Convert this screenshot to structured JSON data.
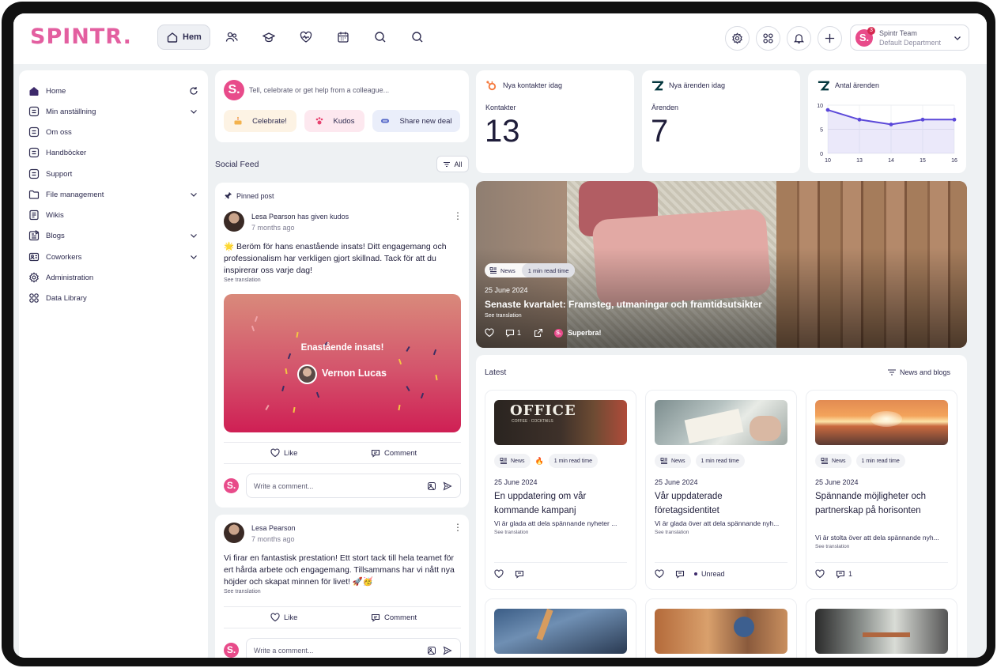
{
  "brand": {
    "logo": "SPINTR.",
    "accent": "#e35fa0"
  },
  "topnav": {
    "home_label": "Hem",
    "icons": [
      "people-icon",
      "graduation-cap-icon",
      "heart-pulse-icon",
      "calendar-icon",
      "search-icon",
      "search-icon"
    ]
  },
  "header_actions": [
    "gear-icon",
    "apps-grid-icon",
    "bell-icon",
    "plus-icon"
  ],
  "profile": {
    "avatar_letter": "S.",
    "badge": "3",
    "name": "Spintr Team",
    "department": "Default Department"
  },
  "sidebar": {
    "items": [
      {
        "label": "Home",
        "icon": "home-icon",
        "chevron": false,
        "refresh": true
      },
      {
        "label": "Min anställning",
        "icon": "page-icon",
        "chevron": true
      },
      {
        "label": "Om oss",
        "icon": "page-icon",
        "chevron": false
      },
      {
        "label": "Handböcker",
        "icon": "page-icon",
        "chevron": false
      },
      {
        "label": "Support",
        "icon": "page-icon",
        "chevron": false
      },
      {
        "label": "File management",
        "icon": "folder-icon",
        "chevron": true
      },
      {
        "label": "Wikis",
        "icon": "book-icon",
        "chevron": false
      },
      {
        "label": "Blogs",
        "icon": "blog-icon",
        "chevron": true
      },
      {
        "label": "Coworkers",
        "icon": "id-card-icon",
        "chevron": true
      },
      {
        "label": "Administration",
        "icon": "gear-icon",
        "chevron": false
      },
      {
        "label": "Data Library",
        "icon": "grid-icon",
        "chevron": false
      }
    ]
  },
  "composer": {
    "avatar_letter": "S.",
    "placeholder": "Tell, celebrate or get help from a colleague...",
    "chips": [
      {
        "label": "Celebrate!",
        "bg": "#fdf3e4"
      },
      {
        "label": "Kudos",
        "bg": "#fde8ef"
      },
      {
        "label": "Share new deal",
        "bg": "#eaeefa"
      }
    ]
  },
  "feed": {
    "title": "Social Feed",
    "filter_label": "All",
    "posts": [
      {
        "pinned_label": "Pinned post",
        "author": "Lesa Pearson",
        "action": "has given kudos",
        "time": "7 months ago",
        "text": "🌟 Beröm för hans enastående insats! Ditt engagemang och professionalism har verkligen gjort skillnad. Tack för att du inspirerar oss varje dag!",
        "see_translation": "See translation",
        "kudos_title": "Enastående insats!",
        "kudos_recipient": "Vernon Lucas",
        "like_label": "Like",
        "comment_label": "Comment",
        "comment_placeholder": "Write a comment..."
      },
      {
        "author": "Lesa Pearson",
        "time": "7 months ago",
        "text": "Vi firar en fantastisk prestation! Ett stort tack till hela teamet för ert hårda arbete och engagemang. Tillsammans har vi nått nya höjder och skapat minnen för livet! 🚀🥳",
        "see_translation": "See translation",
        "like_label": "Like",
        "comment_label": "Comment",
        "comment_placeholder": "Write a comment..."
      }
    ]
  },
  "stats": [
    {
      "title": "Nya kontakter idag",
      "label": "Kontakter",
      "value": "13",
      "icon": "hubspot-icon",
      "icon_color": "#f57b3f"
    },
    {
      "title": "Nya ärenden idag",
      "label": "Ärenden",
      "value": "7",
      "icon": "zendesk-icon",
      "icon_color": "#03363d"
    },
    {
      "title": "Antal ärenden",
      "icon": "zendesk-icon"
    }
  ],
  "chart_data": {
    "type": "area",
    "x": [
      10,
      13,
      14,
      15,
      16
    ],
    "values": [
      9,
      7,
      6,
      7,
      7
    ],
    "yticks": [
      0,
      5,
      10
    ],
    "ylim": [
      0,
      10
    ],
    "grid": true,
    "color": "#5b48d9"
  },
  "hero": {
    "badge_news": "News",
    "badge_read": "1 min read time",
    "date": "25 June 2024",
    "title": "Senaste kvartalet: Framsteg, utmaningar och framtidsutsikter",
    "see_translation": "See translation",
    "comments": "1",
    "reaction_label": "Superbra!"
  },
  "latest": {
    "title": "Latest",
    "filter_label": "News and blogs",
    "cards": [
      {
        "badge_news": "News",
        "fire": "🔥",
        "badge_read": "1 min read time",
        "date": "25 June 2024",
        "title": "En uppdatering om vår kommande kampanj",
        "desc": "Vi är glada att dela spännande nyheter ...",
        "see_translation": "See translation",
        "comments": "",
        "status": ""
      },
      {
        "badge_news": "News",
        "fire": "",
        "badge_read": "1 min read time",
        "date": "25 June 2024",
        "title": "Vår uppdaterade företagsidentitet",
        "desc": "Vi är glada över att dela spännande nyh...",
        "see_translation": "See translation",
        "comments": "",
        "status": "Unread"
      },
      {
        "badge_news": "News",
        "fire": "",
        "badge_read": "1 min read time",
        "date": "25 June 2024",
        "title": "Spännande möjligheter och partnerskap på horisonten",
        "desc": "Vi är stolta över att dela spännande nyh...",
        "see_translation": "See translation",
        "comments": "1",
        "status": ""
      }
    ],
    "office_sign": "OFFICE",
    "office_sub": "COFFEE · COCKTAILS"
  }
}
